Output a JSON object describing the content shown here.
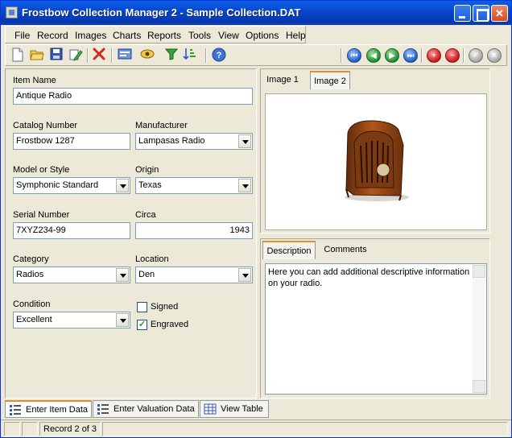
{
  "window": {
    "title": "Frostbow Collection Manager 2 - Sample Collection.DAT"
  },
  "menu": [
    "File",
    "Record",
    "Images",
    "Charts",
    "Reports",
    "Tools",
    "View",
    "Options",
    "Help"
  ],
  "toolbar_icons": [
    "new-file-icon",
    "open-folder-icon",
    "save-icon",
    "edit-icon",
    "delete-icon",
    "card-icon",
    "view-eye-icon",
    "filter-icon",
    "sort-icon",
    "help-icon"
  ],
  "nav_icons": [
    "first-record-icon",
    "previous-record-icon",
    "next-record-icon",
    "last-record-icon",
    "add-record-icon",
    "remove-record-icon",
    "confirm-icon",
    "cancel-icon"
  ],
  "fields": {
    "item_name": {
      "label": "Item Name",
      "value": "Antique Radio"
    },
    "catalog_number": {
      "label": "Catalog Number",
      "value": "Frostbow 1287"
    },
    "manufacturer": {
      "label": "Manufacturer",
      "value": "Lampasas Radio"
    },
    "model_or_style": {
      "label": "Model or Style",
      "value": "Symphonic Standard"
    },
    "origin": {
      "label": "Origin",
      "value": "Texas"
    },
    "serial_number": {
      "label": "Serial Number",
      "value": "7XYZ234-99"
    },
    "circa": {
      "label": "Circa",
      "value": "1943"
    },
    "category": {
      "label": "Category",
      "value": "Radios"
    },
    "location": {
      "label": "Location",
      "value": "Den"
    },
    "condition": {
      "label": "Condition",
      "value": "Excellent"
    },
    "signed": {
      "label": "Signed",
      "checked": false
    },
    "engraved": {
      "label": "Engraved",
      "checked": true
    }
  },
  "image_tabs": [
    {
      "label": "Image 1",
      "active": false
    },
    {
      "label": "Image 2",
      "active": true
    }
  ],
  "notes_tabs": [
    {
      "label": "Description",
      "active": true
    },
    {
      "label": "Comments",
      "active": false
    }
  ],
  "description_text": "Here you can add additional descriptive information on your radio.",
  "bottom_tabs": [
    {
      "label": "Enter Item Data",
      "active": true
    },
    {
      "label": "Enter Valuation Data",
      "active": false
    },
    {
      "label": "View Table",
      "active": false
    }
  ],
  "status": {
    "record": "Record 2 of 3"
  },
  "colors": {
    "titlebar": "#0847c9",
    "face": "#ece9d8",
    "input_border": "#7f9db9"
  }
}
